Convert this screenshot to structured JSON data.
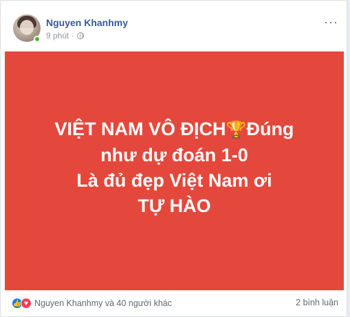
{
  "post": {
    "author": "Nguyen Khanhmy",
    "time": "9 phút ·",
    "text_lines": [
      "VIỆT NAM VÔ ĐỊCH",
      "Đúng",
      "như dự đoán 1-0",
      "Là đủ đẹp Việt Nam ơi",
      "TỰ HÀO"
    ],
    "trophy": "🏆",
    "background_color": "#e4483c",
    "more_icon": "···"
  },
  "footer": {
    "reactions_text": "Nguyen Khanhmy và 40 người khác",
    "comments_text": "2 bình luận",
    "like_icon_glyph": "👍",
    "love_icon_glyph": "♥"
  },
  "icons": {
    "avatar": "avatar-icon",
    "online": "online-dot-icon",
    "privacy": "globe-icon",
    "more": "more-options-icon",
    "like": "like-icon",
    "love": "love-icon"
  }
}
